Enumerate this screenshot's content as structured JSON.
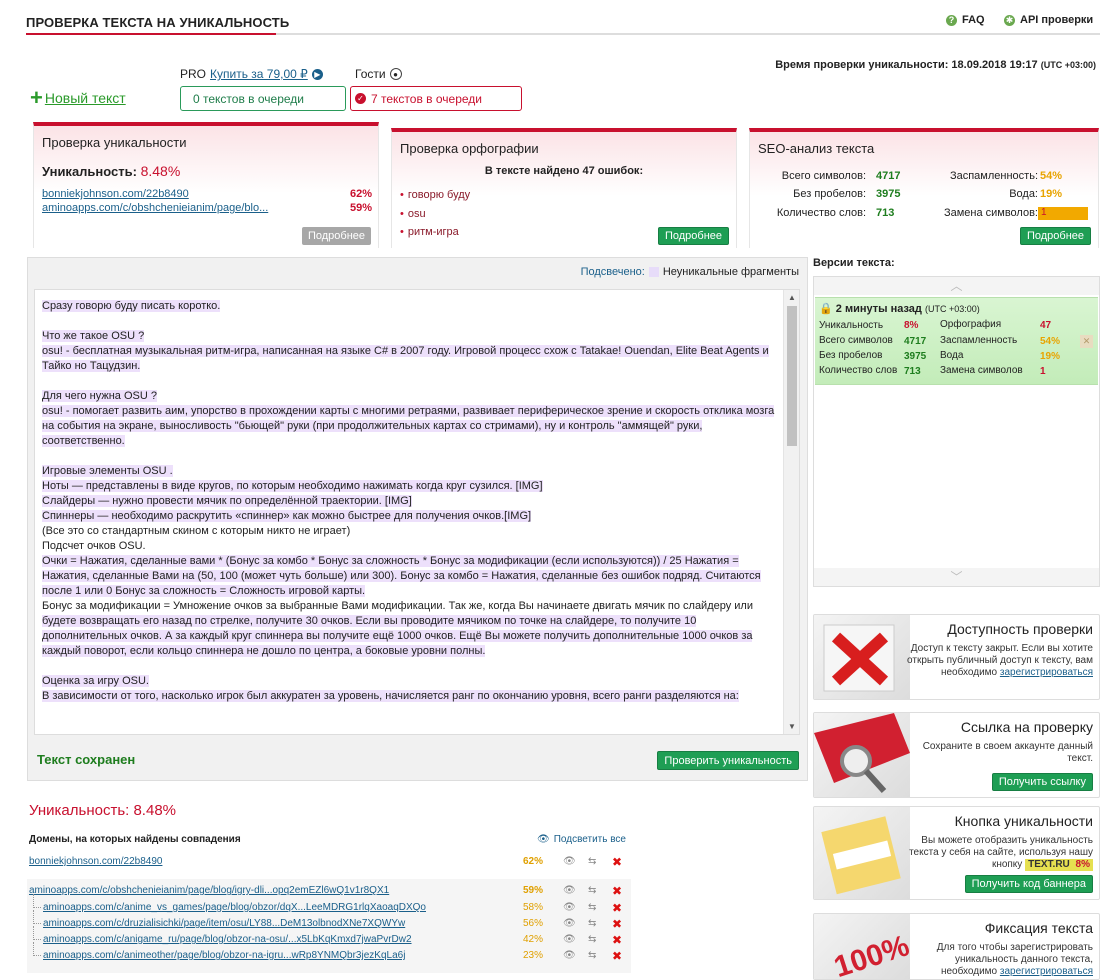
{
  "header": {
    "title": "ПРОВЕРКА ТЕКСТА НА УНИКАЛЬНОСТЬ",
    "faq": "FAQ",
    "api": "API проверки"
  },
  "check_time": {
    "label": "Время проверки уникальности: 18.09.2018 19:17",
    "tz": "(UTC +03:00)"
  },
  "new_text": "Новый текст",
  "pro": {
    "label": "PRO",
    "buy": "Купить за 79,00 ₽",
    "queue": "0 текстов в очереди"
  },
  "guests": {
    "label": "Гости",
    "queue": "7 текстов в очереди"
  },
  "panel_unique": {
    "title": "Проверка уникальности",
    "uniq_label": "Уникальность:",
    "uniq_value": "8.48%",
    "sources": [
      {
        "url": "bonniekjohnson.com/22b8490",
        "pct": "62%"
      },
      {
        "url": "aminoapps.com/c/obshchenieianim/page/blo...",
        "pct": "59%"
      }
    ],
    "more": "Подробнее"
  },
  "panel_ortho": {
    "title": "Проверка орфографии",
    "subtitle": "В тексте найдено 47 ошибок:",
    "items": [
      "говорю буду",
      "osu",
      "ритм-игра"
    ],
    "more": "Подробнее"
  },
  "panel_seo": {
    "title": "SEO-анализ текста",
    "total_label": "Всего символов:",
    "total": "4717",
    "nospace_label": "Без пробелов:",
    "nospace": "3975",
    "words_label": "Количество слов:",
    "words": "713",
    "spam_label": "Заспамленность:",
    "spam": "54%",
    "water_label": "Вода:",
    "water": "19%",
    "replace_label": "Замена символов:",
    "replace": "1",
    "more": "Подробнее"
  },
  "editor": {
    "legend_label": "Подсвечено:",
    "legend_text": "Неуникальные фрагменты",
    "saved": "Текст сохранен",
    "check_button": "Проверить уникальность",
    "lines": [
      "Сразу говорю буду писать коротко.",
      "",
      "Что же такое OSU ?",
      "osu! - бесплатная музыкальная ритм-игра, написанная на языке C# в 2007 году. Игровой процесс схож с Tatakae! Ouendan, Elite Beat Agents и",
      "Тайко но Тацудзин.",
      "",
      "Для чего нужна OSU ?",
      "osu! - помогает развить аим, упорство в прохождении карты с многими ретраями, развивает периферическое зрение и скорость отклика мозга",
      "на события на экране, выносливость \"бьющей\" руки (при продолжительных картах со стримами), ну и контроль \"аммящей\" руки,",
      "соответственно.",
      "",
      "Игровые элементы OSU .",
      "Ноты — представлены в виде кругов, по которым необходимо нажимать когда круг сузился. [IMG]",
      "Слайдеры — нужно провести мячик по определённой траектории. [IMG]",
      "Спиннеры — необходимо раскрутить «спиннер» как можно быстрее для получения очков.[IMG]",
      "(Все это со стандартным скином с которым никто не играет)",
      "Подсчет очков OSU.",
      "Очки = Нажатия, сделанные вами * (Бонус за комбо * Бонус за сложность * Бонус за модификации (если используются)) / 25 Нажатия =",
      "Нажатия, сделанные Вами на (50, 100 (может чуть больше) или 300). Бонус за комбо = Нажатия, сделанные без ошибок подряд. Считаются",
      "после 1 или 0 Бонус за сложность = Сложность игровой карты.",
      "Бонус за модификации = Умножение очков за выбранные Вами модификации. Так же, когда Вы начинаете двигать мячик по слайдеру или",
      "будете возвращать его назад по стрелке, получите 30 очков. Если вы проводите мячиком по точке на слайдере, то получите 10",
      "дополнительных очков. А за каждый круг спиннера вы получите ещё 1000 очков. Ещё Вы можете получить дополнительные 1000 очков за",
      "каждый поворот, если кольцо спиннера не дошло по центра, а боковые уровни полны.",
      "",
      "Оценка за игру OSU.",
      "В зависимости от того, насколько игрок был аккуратен за уровень, начисляется ранг по окончанию уровня, всего ранги разделяются на:"
    ]
  },
  "versions": {
    "title": "Версии текста:",
    "item": {
      "time": "2 минуты назад",
      "tz": "(UTC +03:00)",
      "uniq_label": "Уникальность",
      "uniq": "8%",
      "ortho_label": "Орфография",
      "ortho": "47",
      "total_label": "Всего символов",
      "total": "4717",
      "spam_label": "Заспамленность",
      "spam": "54%",
      "nospace_label": "Без пробелов",
      "nospace": "3975",
      "water_label": "Вода",
      "water": "19%",
      "words_label": "Количество слов",
      "words": "713",
      "replace_label": "Замена символов",
      "replace": "1"
    }
  },
  "cards": [
    {
      "title": "Доступность проверки",
      "text": "Доступ к тексту закрыт. Если вы хотите открыть публичный доступ к тексту, вам необходимо",
      "link": "зарегистрироваться",
      "button": ""
    },
    {
      "title": "Ссылка на проверку",
      "text": "Сохраните в своем аккаунте данный текст.",
      "link": "",
      "button": "Получить ссылку"
    },
    {
      "title": "Кнопка уникальности",
      "text": "Вы можете отобразить уникальность текста у себя на сайте, используя нашу кнопку",
      "link": "",
      "badge": "TEXT.RU",
      "badge_val": "8%",
      "button": "Получить код баннера"
    },
    {
      "title": "Фиксация текста",
      "text": "Для того чтобы зарегистрировать уникальность данного текста, необходимо",
      "link": "зарегистрироваться",
      "button": ""
    }
  ],
  "results": {
    "uniq_title": "Уникальность: 8.48%",
    "domains_header": "Домены, на которых найдены совпадения",
    "highlight_all": "Подсветить все",
    "rows": [
      {
        "url": "bonniekjohnson.com/22b8490",
        "pct": "62%",
        "sub": false
      },
      {
        "url": "aminoapps.com/c/obshchenieianim/page/blog/igry-dli...opq2emEZl6wQ1v1r8QX1",
        "pct": "59%",
        "sub": false
      },
      {
        "url": "aminoapps.com/c/anime_vs_games/page/blog/obzor/dqX...LeeMDRG1rlqXaoaqDXQo",
        "pct": "58%",
        "sub": true
      },
      {
        "url": "aminoapps.com/c/druzialisichki/page/item/osu/LY88...DeM13olbnodXNe7XQWYw",
        "pct": "56%",
        "sub": true
      },
      {
        "url": "aminoapps.com/c/anigame_ru/page/blog/obzor-na-osu/...x5LbKqKmxd7jwaPvrDw2",
        "pct": "42%",
        "sub": true
      },
      {
        "url": "aminoapps.com/c/animeother/page/blog/obzor-na-igru...wRp8YNMQbr3jezKqLa6j",
        "pct": "23%",
        "sub": true
      }
    ]
  }
}
